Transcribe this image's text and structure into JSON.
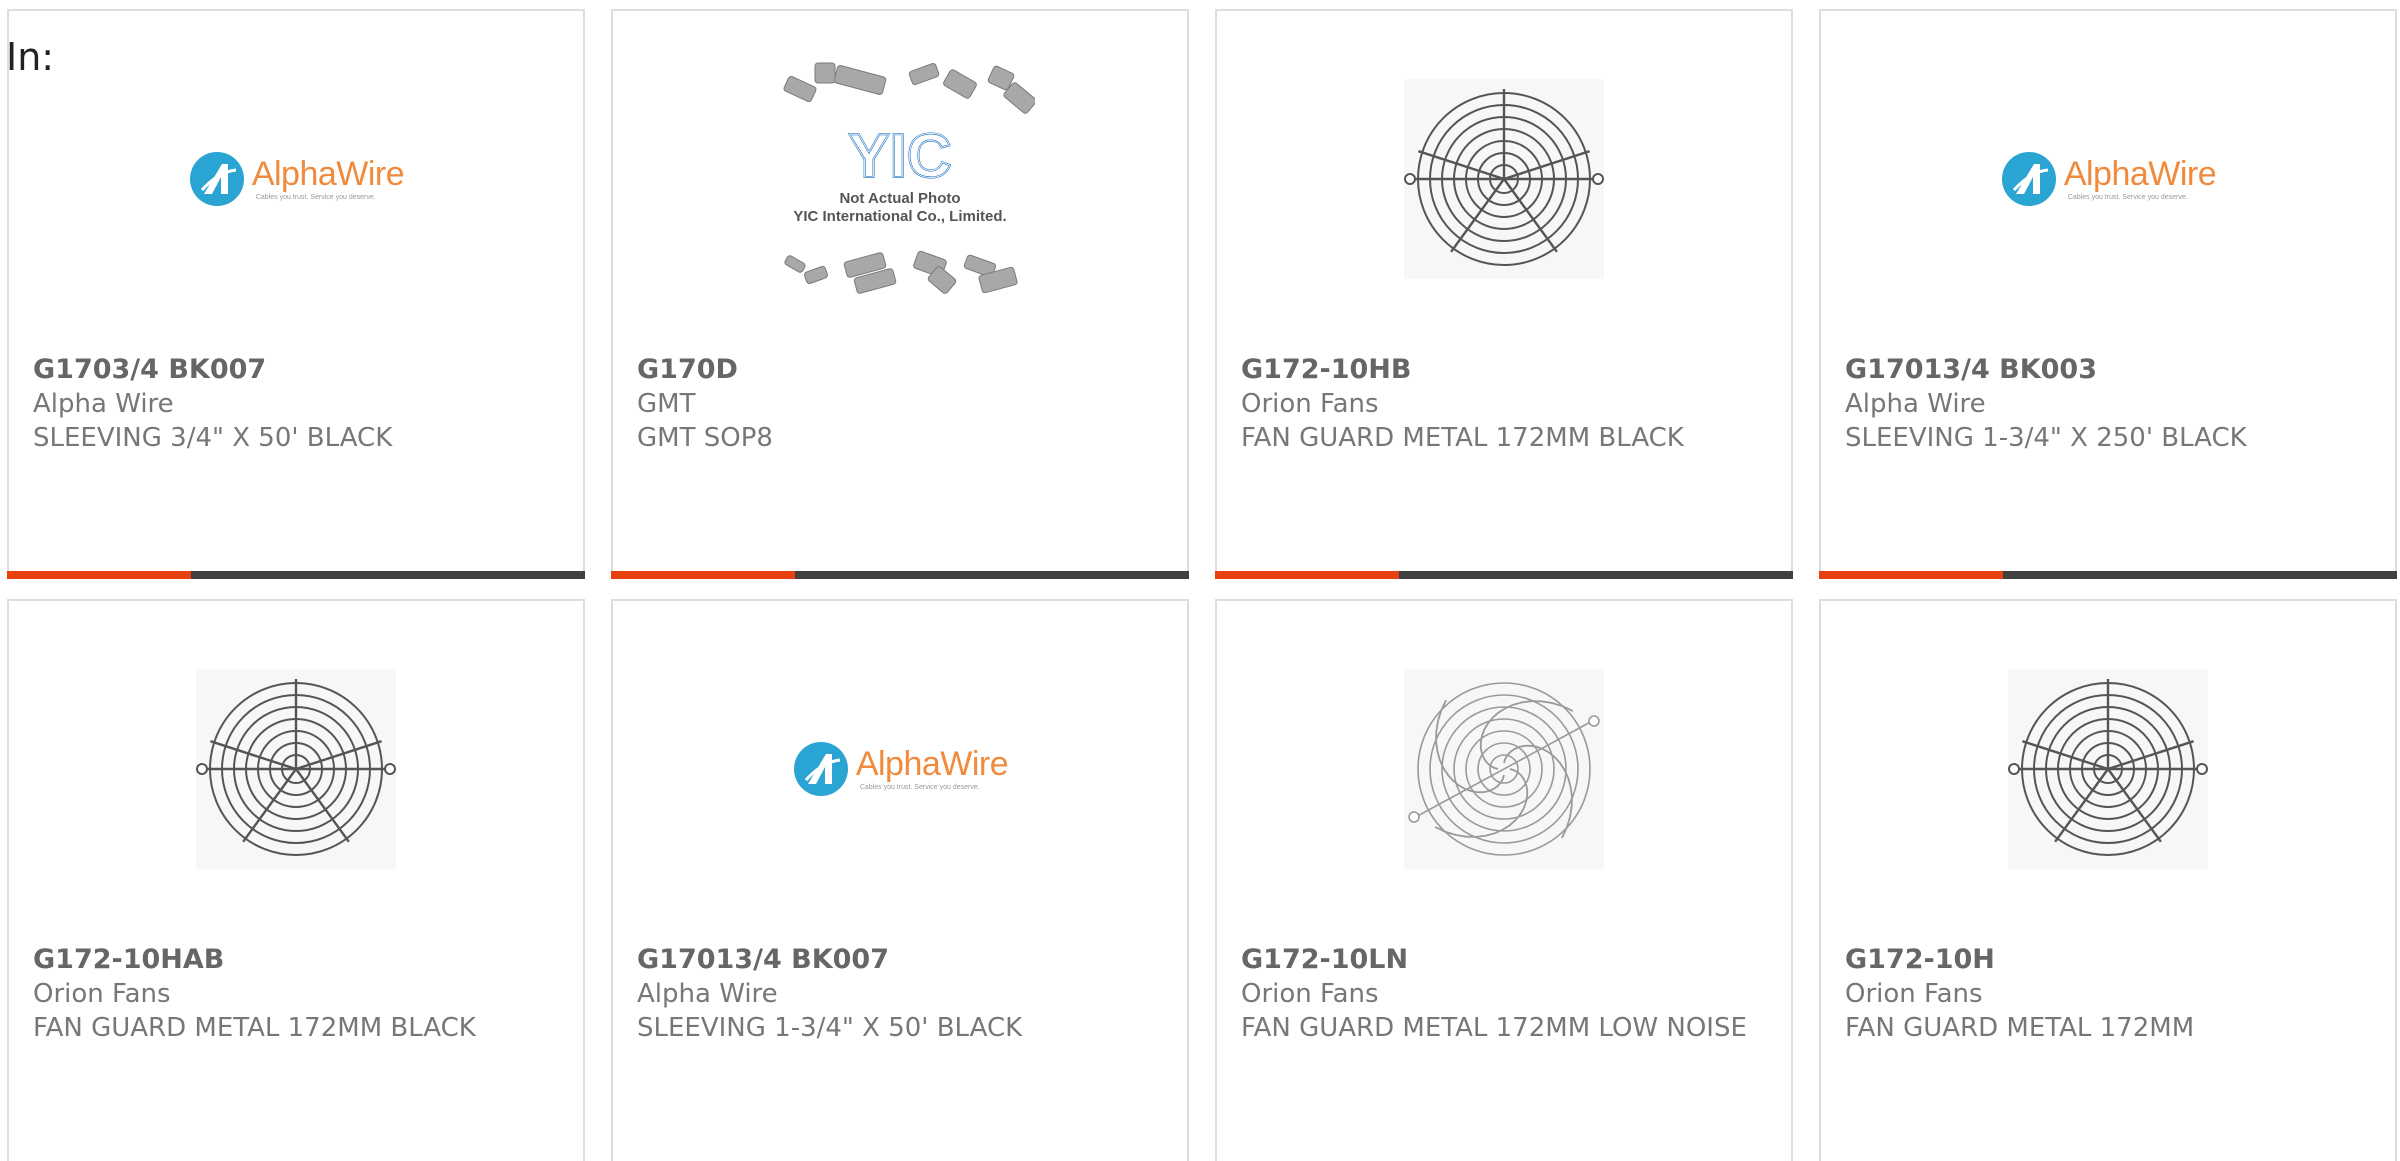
{
  "header": {
    "label": "In:"
  },
  "colors": {
    "accent": "#e8400f",
    "bar": "#404040",
    "card_border": "#dedede",
    "text": "#777777",
    "alpha_wire_orange": "#f08a3c",
    "alpha_wire_blue": "#2aa4d3"
  },
  "products": [
    {
      "part_number": "G1703/4 BK007",
      "manufacturer": "Alpha Wire",
      "description": "SLEEVING 3/4\" X 50' BLACK",
      "image": "alphawire-logo"
    },
    {
      "part_number": "G170D",
      "manufacturer": "GMT",
      "description": "GMT SOP8",
      "image": "yic-placeholder"
    },
    {
      "part_number": "G172-10HB",
      "manufacturer": "Orion Fans",
      "description": "FAN GUARD METAL 172MM BLACK",
      "image": "fan-guard"
    },
    {
      "part_number": "G17013/4 BK003",
      "manufacturer": "Alpha Wire",
      "description": "SLEEVING 1-3/4\" X 250' BLACK",
      "image": "alphawire-logo"
    },
    {
      "part_number": "G172-10HAB",
      "manufacturer": "Orion Fans",
      "description": "FAN GUARD METAL 172MM BLACK",
      "image": "fan-guard"
    },
    {
      "part_number": "G17013/4 BK007",
      "manufacturer": "Alpha Wire",
      "description": "SLEEVING 1-3/4\" X 50' BLACK",
      "image": "alphawire-logo"
    },
    {
      "part_number": "G172-10LN",
      "manufacturer": "Orion Fans",
      "description": "FAN GUARD METAL 172MM LOW NOISE",
      "image": "fan-guard-spiral"
    },
    {
      "part_number": "G172-10H",
      "manufacturer": "Orion Fans",
      "description": "FAN GUARD METAL 172MM",
      "image": "fan-guard"
    }
  ],
  "logos": {
    "alpha_wire_name": "AlphaWire",
    "alpha_wire_tagline": "Cables you trust. Service you deserve.",
    "yic_mark": "YIC",
    "yic_caption_line1": "Not Actual Photo",
    "yic_caption_line2": "YIC International Co., Limited."
  }
}
